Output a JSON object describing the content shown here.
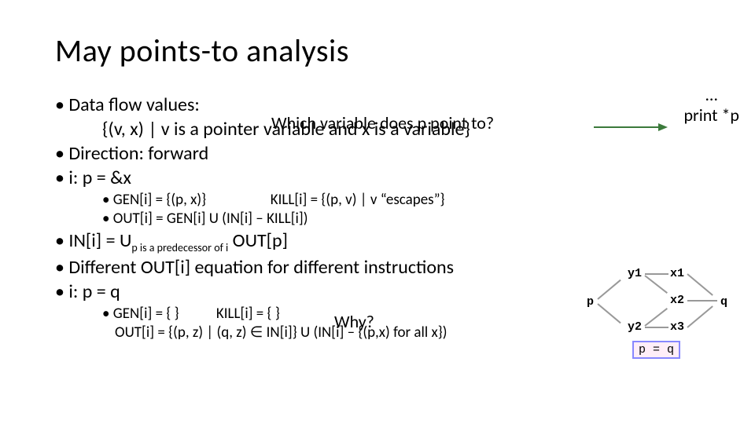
{
  "title": "May points-to analysis",
  "top_right": {
    "line1": "…",
    "line2": "print *p"
  },
  "annot_q": "Which variable does p point to?",
  "annot_why": "Why?",
  "bullets": {
    "dfv": "Data flow values:",
    "dfv_set": "{(v, x) | v is a pointer variable and x is a variable}",
    "dir": "Direction: forward",
    "i1": "i: p = &x",
    "i1_gen": "GEN[i] = {(p, x)}",
    "i1_kill": "KILL[i] = {(p, v) | v “escapes”}",
    "i1_out": "OUT[i] = GEN[i] U (IN[i] – KILL[i])",
    "in_lhs": "IN[i] = U",
    "in_sub": "p is a predecessor of i",
    "in_rhs": " OUT[p]",
    "diff": "Different OUT[i] equation for different instructions",
    "i2": "i: p = q",
    "i2_gen": "GEN[i] = { }",
    "i2_kill": "KILL[i] = { }",
    "i2_out": "OUT[i] = {(p, z) | (q, z) ∈ IN[i]}  U  (IN[i] – {(p,x) for all x})"
  },
  "diagram": {
    "p": "p",
    "q": "q",
    "y1": "y1",
    "y2": "y2",
    "x1": "x1",
    "x2": "x2",
    "x3": "x3",
    "box": "p = q"
  }
}
